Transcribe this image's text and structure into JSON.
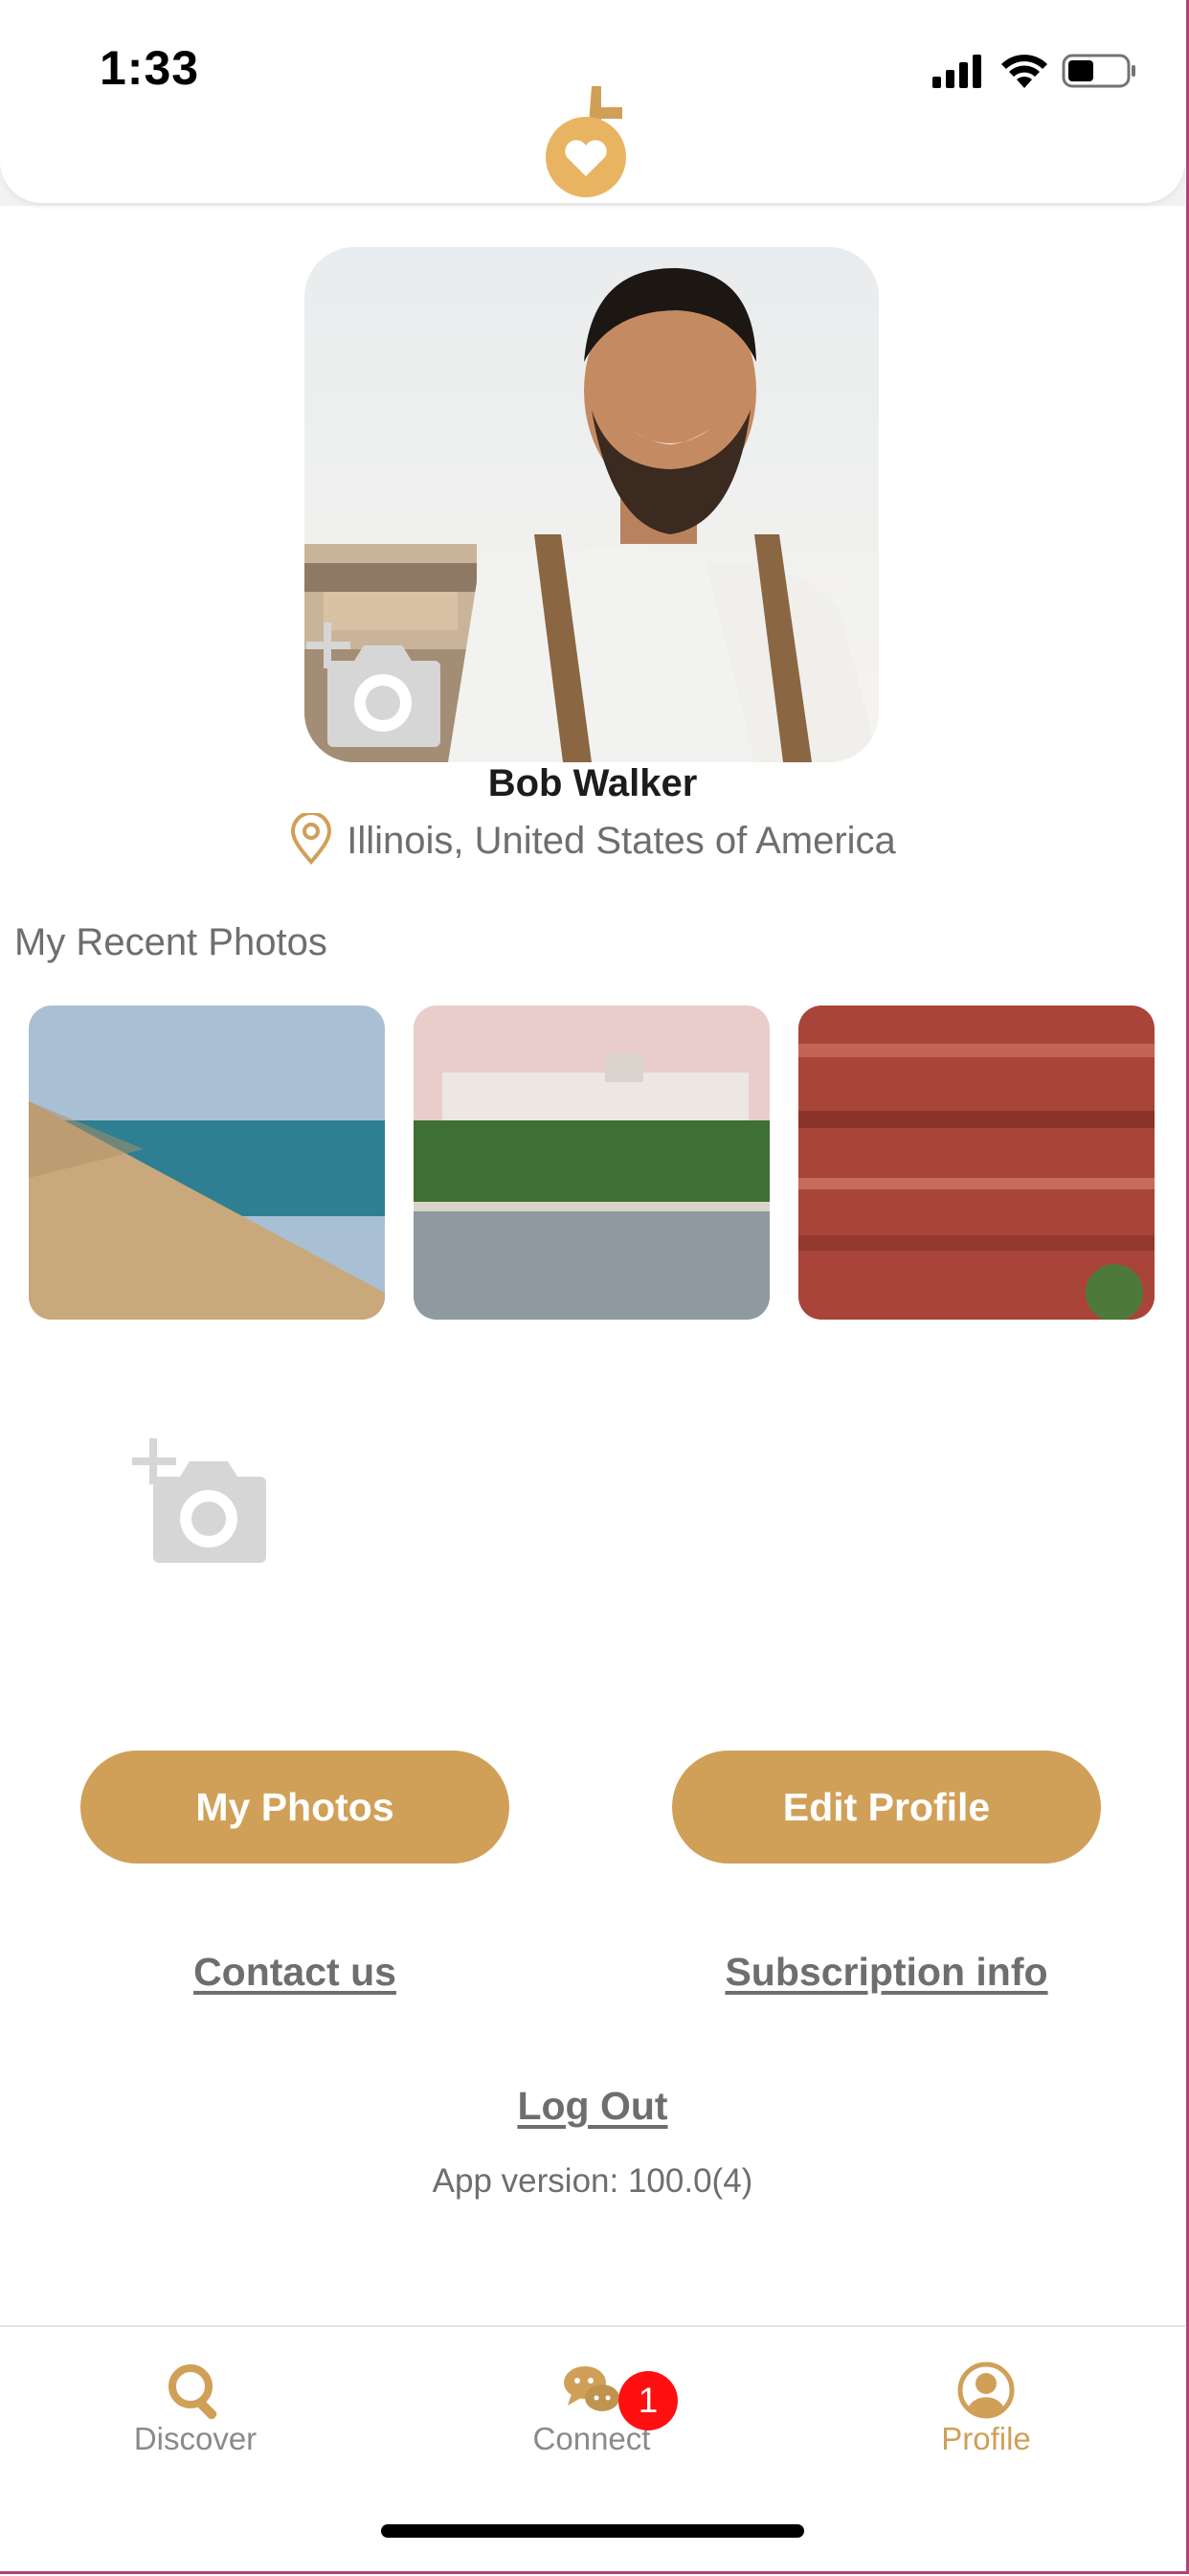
{
  "status_bar": {
    "time": "1:33"
  },
  "colors": {
    "accent": "#d0a058",
    "badge": "#ff0f0f",
    "muted_text": "#6e6e6e"
  },
  "profile": {
    "name": "Bob Walker",
    "location": "Illinois, United States of America"
  },
  "recent_photos": {
    "title": "My Recent Photos",
    "items": [
      {
        "icon": "sand-dune-lake-photo"
      },
      {
        "icon": "hotel-on-water-photo"
      },
      {
        "icon": "red-rock-cliff-photo"
      }
    ]
  },
  "actions": {
    "my_photos": "My Photos",
    "edit_profile": "Edit Profile",
    "contact_us": "Contact us",
    "subscription_info": "Subscription info",
    "log_out": "Log Out",
    "app_version": "App version: 100.0(4)"
  },
  "tabs": [
    {
      "label": "Discover",
      "icon": "search-icon",
      "active": false
    },
    {
      "label": "Connect",
      "icon": "chat-icon",
      "active": false,
      "badge": "1"
    },
    {
      "label": "Profile",
      "icon": "user-icon",
      "active": true
    }
  ]
}
